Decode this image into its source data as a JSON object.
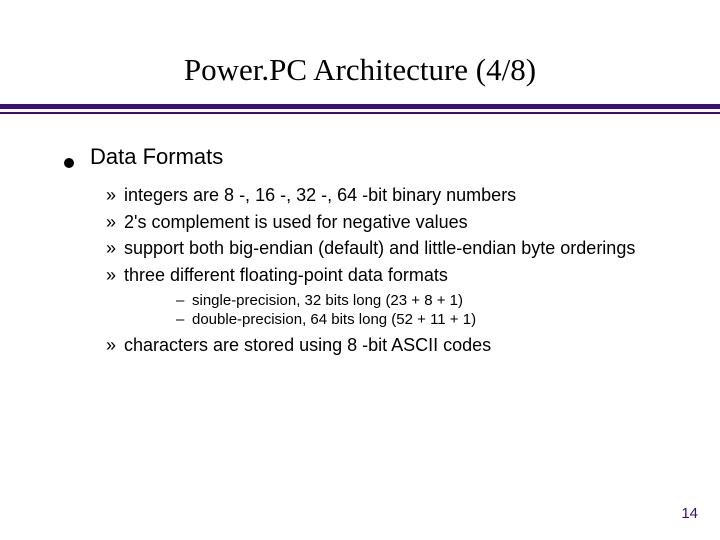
{
  "title": "Power.PC Architecture (4/8)",
  "section": {
    "heading": "Data Formats",
    "items": [
      {
        "text": "integers are 8 -, 16 -, 32 -, 64 -bit binary numbers"
      },
      {
        "text": "2's complement is used for negative values"
      },
      {
        "text": "support both big-endian (default) and little-endian byte orderings"
      },
      {
        "text": "three different floating-point data formats",
        "sub": [
          "single-precision, 32 bits long (23 + 8 + 1)",
          "double-precision, 64 bits long (52 + 11 + 1)"
        ]
      },
      {
        "text": "characters are stored using 8 -bit ASCII codes"
      }
    ]
  },
  "markers": {
    "lvl2": "»",
    "lvl3": "–"
  },
  "page_number": "14"
}
